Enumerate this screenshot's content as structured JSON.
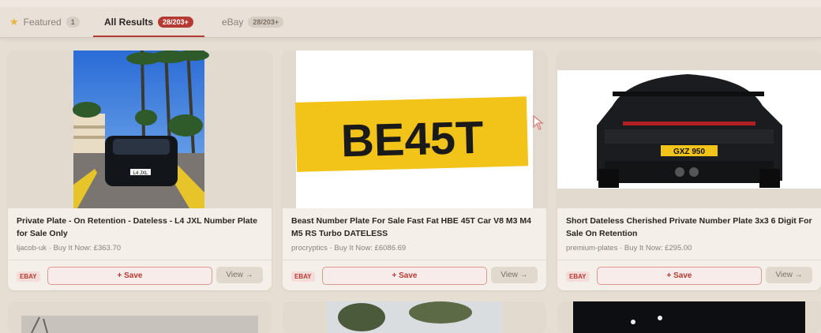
{
  "tabs": [
    {
      "label": "Featured",
      "count": "1"
    },
    {
      "label": "All Results",
      "count": "28/203+"
    },
    {
      "label": "eBay",
      "count": "28/203+"
    }
  ],
  "listings": [
    {
      "title": "Private Plate - On Retention - Dateless - L4 JXL Number Plate for Sale Only",
      "meta": "ljacob-uk · Buy It Now: £363.70",
      "source": "EBAY",
      "save_label": "+ Save",
      "view_label": "View →",
      "plate_text": "L4 JXL"
    },
    {
      "title": "Beast Number Plate For Sale Fast Fat HBE 45T Car V8 M3 M4 M5 RS Turbo DATELESS",
      "meta": "procryptics · Buy It Now: £6086.69",
      "source": "EBAY",
      "save_label": "+ Save",
      "view_label": "View →",
      "plate_text": "BE45T"
    },
    {
      "title": "Short Dateless Cherished Private Number Plate 3x3 6 Digit For Sale On Retention",
      "meta": "premium-plates · Buy It Now: £295.00",
      "source": "EBAY",
      "save_label": "+ Save",
      "view_label": "View →",
      "plate_text": "GXZ 950"
    }
  ],
  "colors": {
    "accent": "#b63a34",
    "background": "#e6ddd3",
    "card": "#f4efe9",
    "plate_yellow": "#f2c318"
  }
}
